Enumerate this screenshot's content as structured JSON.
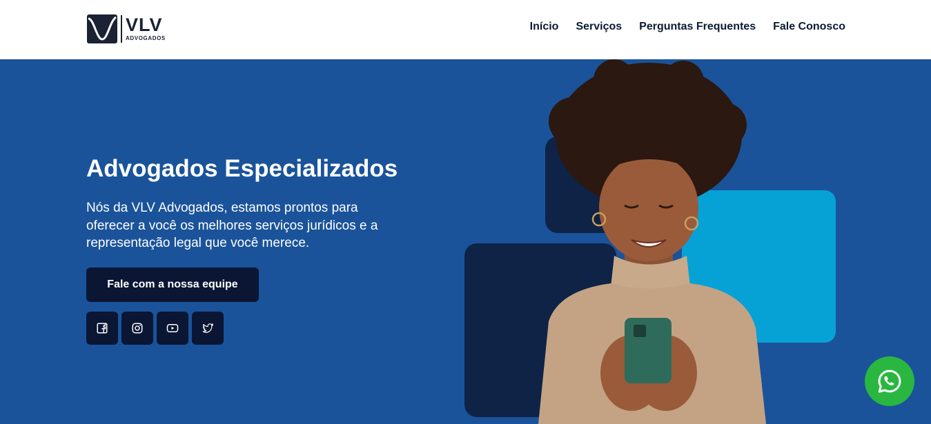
{
  "brand": {
    "name": "VLV",
    "subtitle": "ADVOGADOS"
  },
  "nav": {
    "items": [
      {
        "label": "Início"
      },
      {
        "label": "Serviços"
      },
      {
        "label": "Perguntas Frequentes"
      },
      {
        "label": "Fale Conosco"
      }
    ]
  },
  "hero": {
    "title": "Advogados Especializados",
    "description": "Nós da VLV Advogados, estamos prontos para oferecer a você os melhores serviços jurídicos e a representação legal que você merece.",
    "cta_label": "Fale com a nossa equipe"
  },
  "socials": [
    {
      "icon": "facebook-icon"
    },
    {
      "icon": "instagram-icon"
    },
    {
      "icon": "youtube-icon"
    },
    {
      "icon": "twitter-icon"
    }
  ],
  "floating": {
    "icon": "whatsapp-icon"
  },
  "colors": {
    "hero_bg": "#1a539a",
    "dark_navy": "#0a1634",
    "accent_cyan": "#06a2d6",
    "whatsapp_green": "#29b741"
  }
}
